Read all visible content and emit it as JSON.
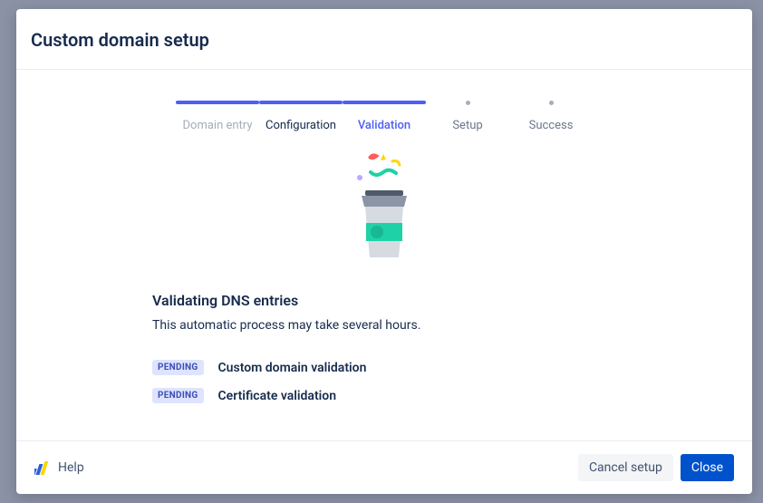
{
  "modal": {
    "title": "Custom domain setup"
  },
  "stepper": {
    "steps": [
      {
        "label": "Domain entry",
        "state": "completed"
      },
      {
        "label": "Configuration",
        "state": "completed2"
      },
      {
        "label": "Validation",
        "state": "active"
      },
      {
        "label": "Setup",
        "state": "future"
      },
      {
        "label": "Success",
        "state": "future"
      }
    ]
  },
  "content": {
    "heading": "Validating DNS entries",
    "description": "This automatic process may take several hours.",
    "statuses": [
      {
        "badge": "PENDING",
        "label": "Custom domain validation"
      },
      {
        "badge": "PENDING",
        "label": "Certificate validation"
      }
    ]
  },
  "footer": {
    "help": "Help",
    "cancel": "Cancel setup",
    "close": "Close"
  }
}
